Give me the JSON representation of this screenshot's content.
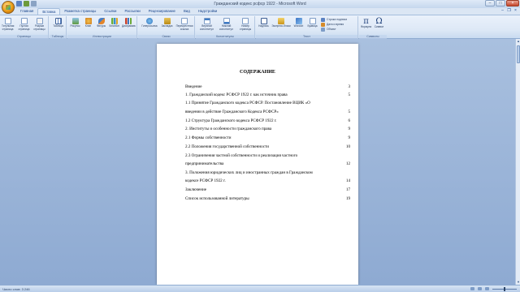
{
  "window": {
    "title": "Гражданский кодекс рсфср 1922 - Microsoft Word",
    "minimize": "–",
    "maximize": "□",
    "close": "×"
  },
  "quick_access": [
    "save-icon",
    "undo-icon",
    "redo-icon"
  ],
  "tabs": [
    {
      "label": "Главная",
      "active": false
    },
    {
      "label": "Вставка",
      "active": true
    },
    {
      "label": "Разметка страницы",
      "active": false
    },
    {
      "label": "Ссылки",
      "active": false
    },
    {
      "label": "Рассылки",
      "active": false
    },
    {
      "label": "Рецензирование",
      "active": false
    },
    {
      "label": "Вид",
      "active": false
    },
    {
      "label": "Надстройки",
      "active": false
    }
  ],
  "ribbon": {
    "pages": {
      "label": "Страницы",
      "title_page": "Титульная\nстраница",
      "blank_page": "Пустая\nстраница",
      "page_break": "Разрыв\nстраницы"
    },
    "tables": {
      "label": "Таблицы",
      "table": "Таблица"
    },
    "illustrations": {
      "label": "Иллюстрации",
      "picture": "Рисунок",
      "clip": "Клип",
      "shapes": "Фигуры",
      "smartart": "SmartArt",
      "chart": "Диаграмма"
    },
    "links": {
      "label": "Связи",
      "hyperlink": "Гиперссылка",
      "bookmark": "Закладка",
      "cross_ref": "Перекрестная\nссылка"
    },
    "header_footer": {
      "label": "Колонтитулы",
      "header": "Верхний\nколонтитул",
      "footer": "Нижний\nколонтитул",
      "page_number": "Номер\nстраницы"
    },
    "text": {
      "label": "Текст",
      "text_box": "Надпись",
      "express_blocks": "Экспресс-блоки",
      "wordart": "WordArt",
      "dropcap": "Буквица",
      "signature_line": "Строка подписи",
      "date_time": "Дата и время",
      "object": "Объект"
    },
    "symbols": {
      "label": "Символы",
      "formula": "Формула",
      "symbol": "Символ",
      "formula_glyph": "π",
      "symbol_glyph": "Ω"
    }
  },
  "document": {
    "toc_title": "СОДЕРЖАНИЕ",
    "entries": [
      {
        "text": "Введение",
        "page": "3"
      },
      {
        "text": "1. Гражданский кодекс РСФСР 1922 г. как источник права",
        "page": "5"
      },
      {
        "text": "1.1 Принятие Гражданского кодекса РСФСР. Постановление ВЦИК «О",
        "page": ""
      },
      {
        "text": "введении в действие Гражданского Кодекса РСФСР»",
        "page": "5"
      },
      {
        "text": "1.2 Структура Гражданского кодекса РСФСР 1922 г.",
        "page": "6"
      },
      {
        "text": "2. Институты и особенности гражданского права",
        "page": "9"
      },
      {
        "text": "2.1 Формы собственности",
        "page": "9"
      },
      {
        "text": "2.2 Положения государственной собственности",
        "page": "10"
      },
      {
        "text": "2.3 Ограничения частной собственности и реализация частного",
        "page": ""
      },
      {
        "text": "предпринимательства",
        "page": "12"
      },
      {
        "text": "3. Положения юридических лиц и иностранных граждан в Гражданском",
        "page": ""
      },
      {
        "text": "кодексе РСФСР 1922 г.",
        "page": "14"
      },
      {
        "text": "Заключение",
        "page": "17"
      },
      {
        "text": "Список использованной литературы",
        "page": "19"
      }
    ]
  },
  "status": {
    "page_info": "Число слов: 3 246"
  },
  "colors": {
    "ribbon_bg": "#dde8f6",
    "workspace_bg": "#a9c0df",
    "accent": "#15428b"
  }
}
